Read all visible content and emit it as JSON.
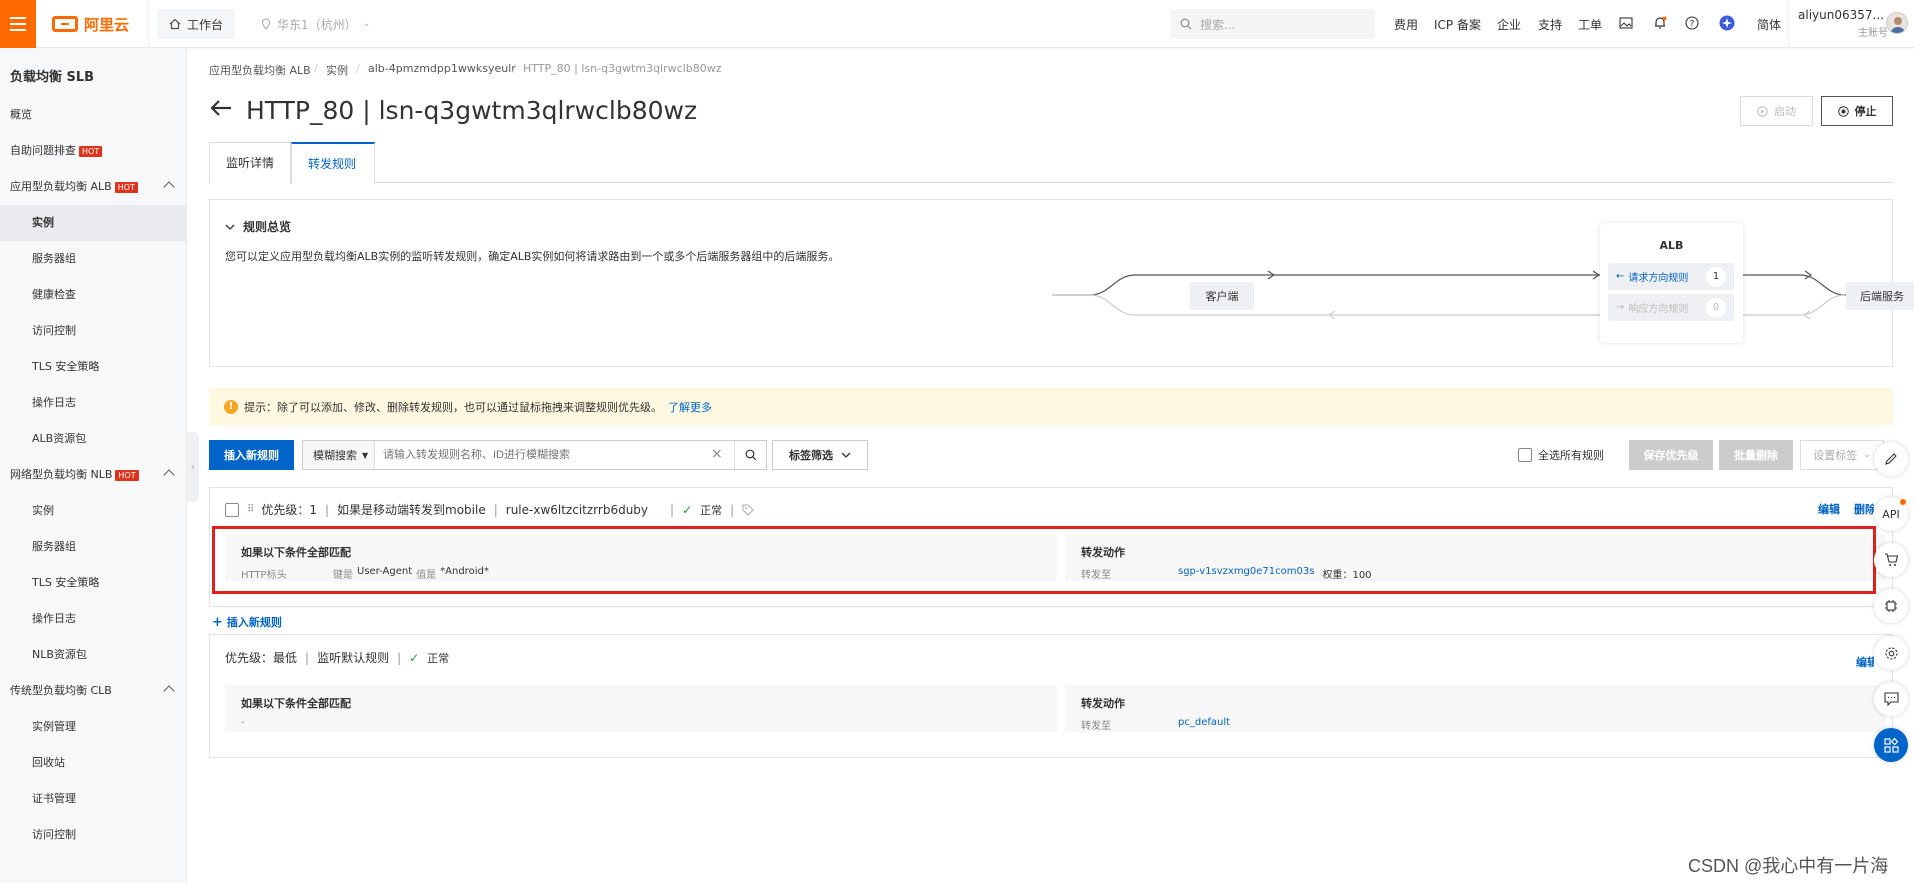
{
  "topbar": {
    "brand": "阿里云",
    "workbench": "工作台",
    "region": "华东1（杭州）",
    "search_placeholder": "搜索...",
    "links": [
      "费用",
      "ICP 备案",
      "企业",
      "支持",
      "工单",
      "简体"
    ],
    "user_name": "aliyun06357...",
    "user_role": "主账号"
  },
  "sidebar": {
    "title": "负载均衡 SLB",
    "hot": "HOT",
    "items": [
      {
        "label": "概览"
      },
      {
        "label": "自助问题排查"
      },
      {
        "label": "应用型负载均衡 ALB"
      },
      {
        "label": "实例"
      },
      {
        "label": "服务器组"
      },
      {
        "label": "健康检查"
      },
      {
        "label": "访问控制"
      },
      {
        "label": "TLS 安全策略"
      },
      {
        "label": "操作日志"
      },
      {
        "label": "ALB资源包"
      },
      {
        "label": "网络型负载均衡 NLB"
      },
      {
        "label": "实例"
      },
      {
        "label": "服务器组"
      },
      {
        "label": "TLS 安全策略"
      },
      {
        "label": "操作日志"
      },
      {
        "label": "NLB资源包"
      },
      {
        "label": "传统型负载均衡 CLB"
      },
      {
        "label": "实例管理"
      },
      {
        "label": "回收站"
      },
      {
        "label": "证书管理"
      },
      {
        "label": "访问控制"
      }
    ]
  },
  "breadcrumb": [
    "应用型负载均衡 ALB",
    "实例",
    "alb-4pmzmdpp1wwksyeulr",
    "HTTP_80 | lsn-q3gwtm3qlrwclb80wz"
  ],
  "page": {
    "title": "HTTP_80 | lsn-q3gwtm3qlrwclb80wz",
    "start_btn": "启动",
    "stop_btn": "停止"
  },
  "tabs": [
    "监听详情",
    "转发规则"
  ],
  "overview": {
    "heading": "规则总览",
    "desc": "您可以定义应用型负载均衡ALB实例的监听转发规则，确定ALB实例如何将请求路由到一个或多个后端服务器组中的后端服务。",
    "client": "客户端",
    "backend": "后端服务",
    "alb": "ALB",
    "req_rule": "请求方向规则",
    "req_count": "1",
    "resp_rule": "响应方向规则",
    "resp_count": "0"
  },
  "tip": {
    "text": "提示：除了可以添加、修改、删除转发规则，也可以通过鼠标拖拽来调整规则优先级。",
    "link": "了解更多"
  },
  "toolbar": {
    "insert": "插入新规则",
    "search_mode": "模糊搜索",
    "search_placeholder": "请输入转发规则名称、ID进行模糊搜索",
    "tag_filter": "标签筛选",
    "select_all": "全选所有规则",
    "save_priority": "保存优先级",
    "batch_delete": "批量删除",
    "set_tag": "设置标签"
  },
  "rules": [
    {
      "priority": "优先级：1",
      "name": "如果是移动端转发到mobile",
      "id": "rule-xw6ltzcitzrrb6duby",
      "status": "正常",
      "edit": "编辑",
      "delete": "删除",
      "cond_title": "如果以下条件全部匹配",
      "cond_type": "HTTP标头",
      "cond_key_label": "键是",
      "cond_key": "User-Agent",
      "cond_val_label": "值是",
      "cond_val": "*Android*",
      "action_title": "转发动作",
      "action_label": "转发至",
      "target": "sgp-v1svzxmg0e71com03s",
      "weight": "权重：100"
    },
    {
      "priority": "优先级：最低",
      "name": "监听默认规则",
      "status": "正常",
      "edit": "编辑",
      "cond_title": "如果以下条件全部匹配",
      "cond_empty": "-",
      "action_title": "转发动作",
      "action_label": "转发至",
      "target": "pc_default"
    }
  ],
  "insert_link": "插入新规则",
  "float_api": "API",
  "watermark": "CSDN @我心中有一片海"
}
